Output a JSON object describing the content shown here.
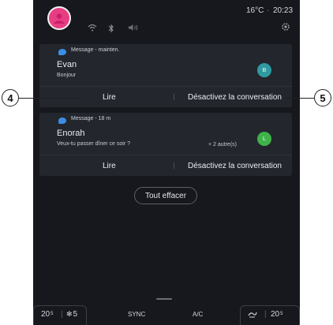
{
  "status": {
    "temperature": "16°C",
    "separator": "·",
    "time": "20:23"
  },
  "notifications": [
    {
      "title": "Message - mainten.",
      "sender": "Evan",
      "preview": "Bonjour",
      "more": "",
      "badge": "B",
      "badge_color": "#2f9aa1",
      "read_label": "Lire",
      "mute_label": "Désactivez la conversation"
    },
    {
      "title": "Message - 18 m",
      "sender": "Enorah",
      "preview": "Veux-tu passer dîner ce soir ?",
      "more": "+ 2 autre(s)",
      "badge": "L",
      "badge_color": "#3fb34a",
      "read_label": "Lire",
      "mute_label": "Désactivez la conversation"
    }
  ],
  "clear_all_label": "Tout effacer",
  "bottom_bar": {
    "left_temp": "20",
    "left_temp_unit": "5",
    "fan_speed": "5",
    "sync_label": "SYNC",
    "ac_label": "A/C",
    "right_temp": "20",
    "right_temp_unit": "5"
  },
  "callouts": {
    "left": "4",
    "right": "5"
  },
  "colors": {
    "screen_bg": "#16181d",
    "card_bg": "#23262d",
    "avatar": "#e83d83",
    "message_icon": "#3b8ee6"
  }
}
